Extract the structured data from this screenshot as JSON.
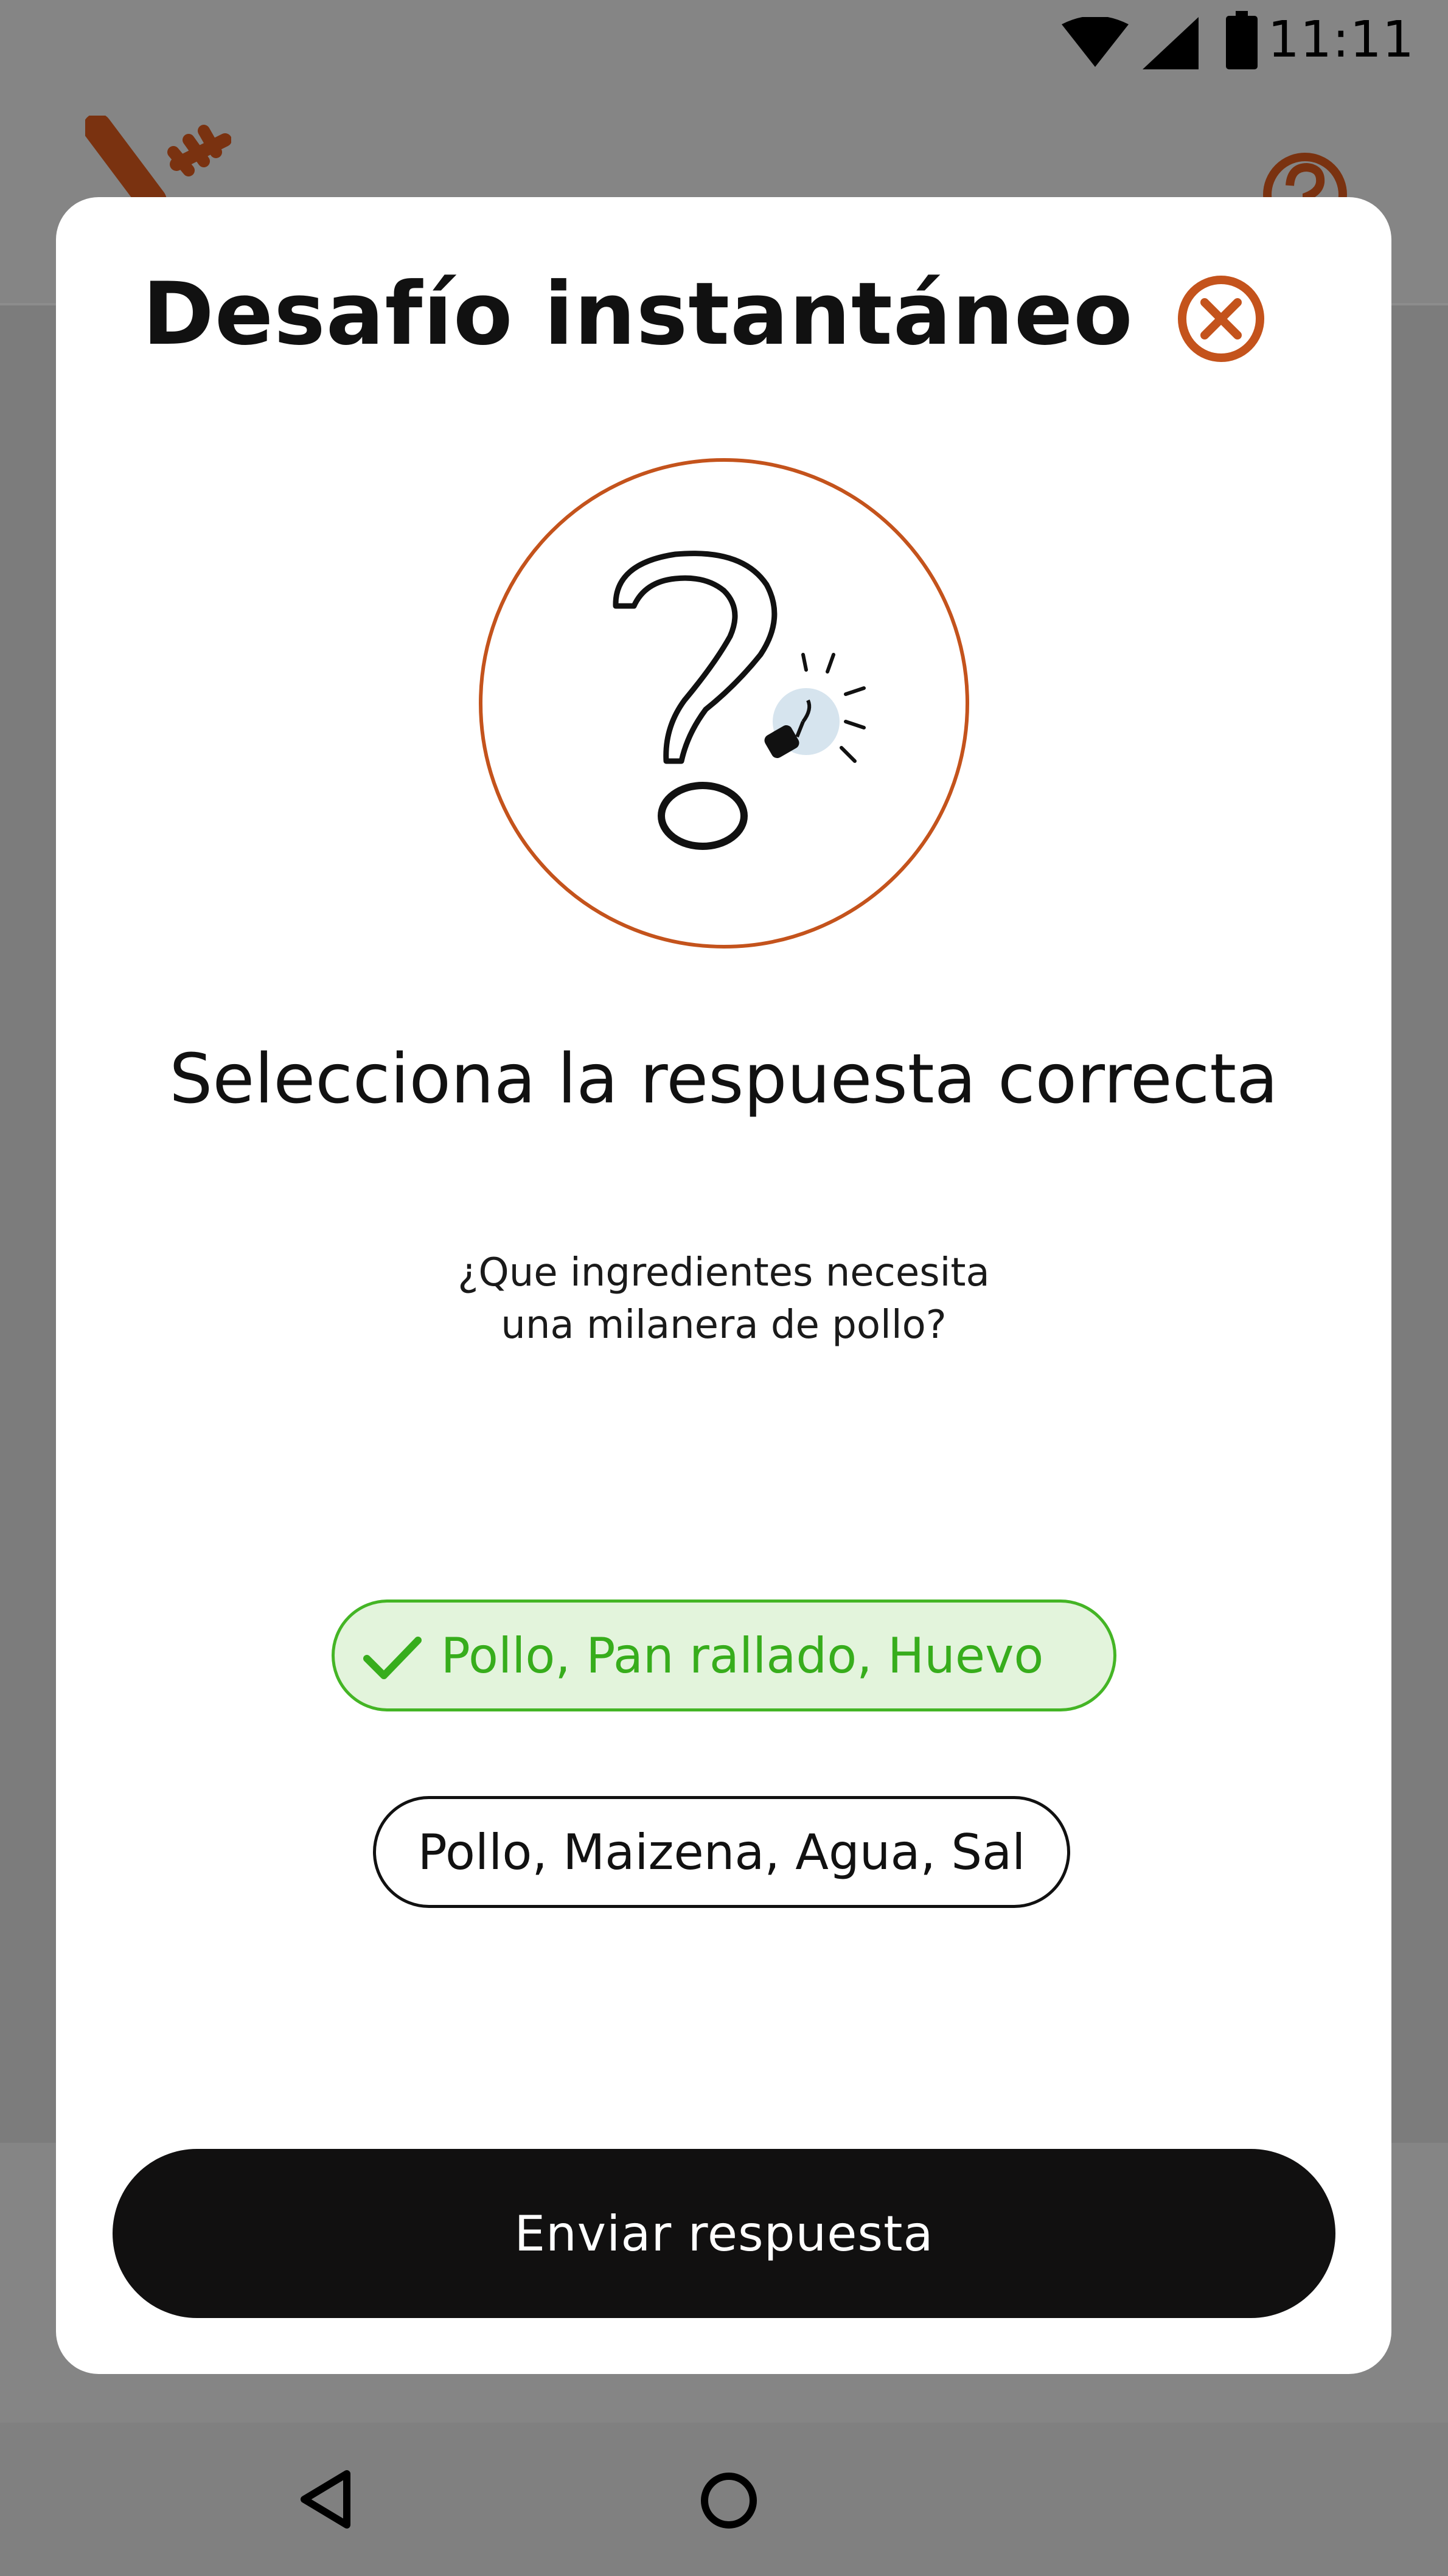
{
  "status_bar": {
    "time": "11:11",
    "icons": [
      "wifi-icon",
      "cellular-signal-icon",
      "battery-icon"
    ]
  },
  "app_header": {
    "logo_icon": "fork-knife-logo",
    "help_icon": "help-icon"
  },
  "dialog": {
    "title": "Desafío instantáneo",
    "close_icon": "close-circle-icon",
    "illustration": "question-mark-lightbulb-icon",
    "instruction": "Selecciona la respuesta correcta",
    "question_line1": "¿Que ingredientes necesita",
    "question_line2": "una milanera de pollo?",
    "options": [
      {
        "label": "Pollo, Pan rallado, Huevo",
        "state": "correct",
        "icon": "checkmark-icon"
      },
      {
        "label": "Pollo, Maizena, Agua, Sal",
        "state": "unselected"
      }
    ],
    "submit_label": "Enviar respuesta"
  },
  "nav_bar": {
    "icons": [
      "back-icon",
      "home-icon"
    ]
  },
  "colors": {
    "accent": "#c4531c",
    "correct_text": "#37ad1c",
    "correct_border": "#44b525",
    "correct_background": "#e3f4dc",
    "button_background": "#111010",
    "scrim": "#7f7f7f"
  }
}
